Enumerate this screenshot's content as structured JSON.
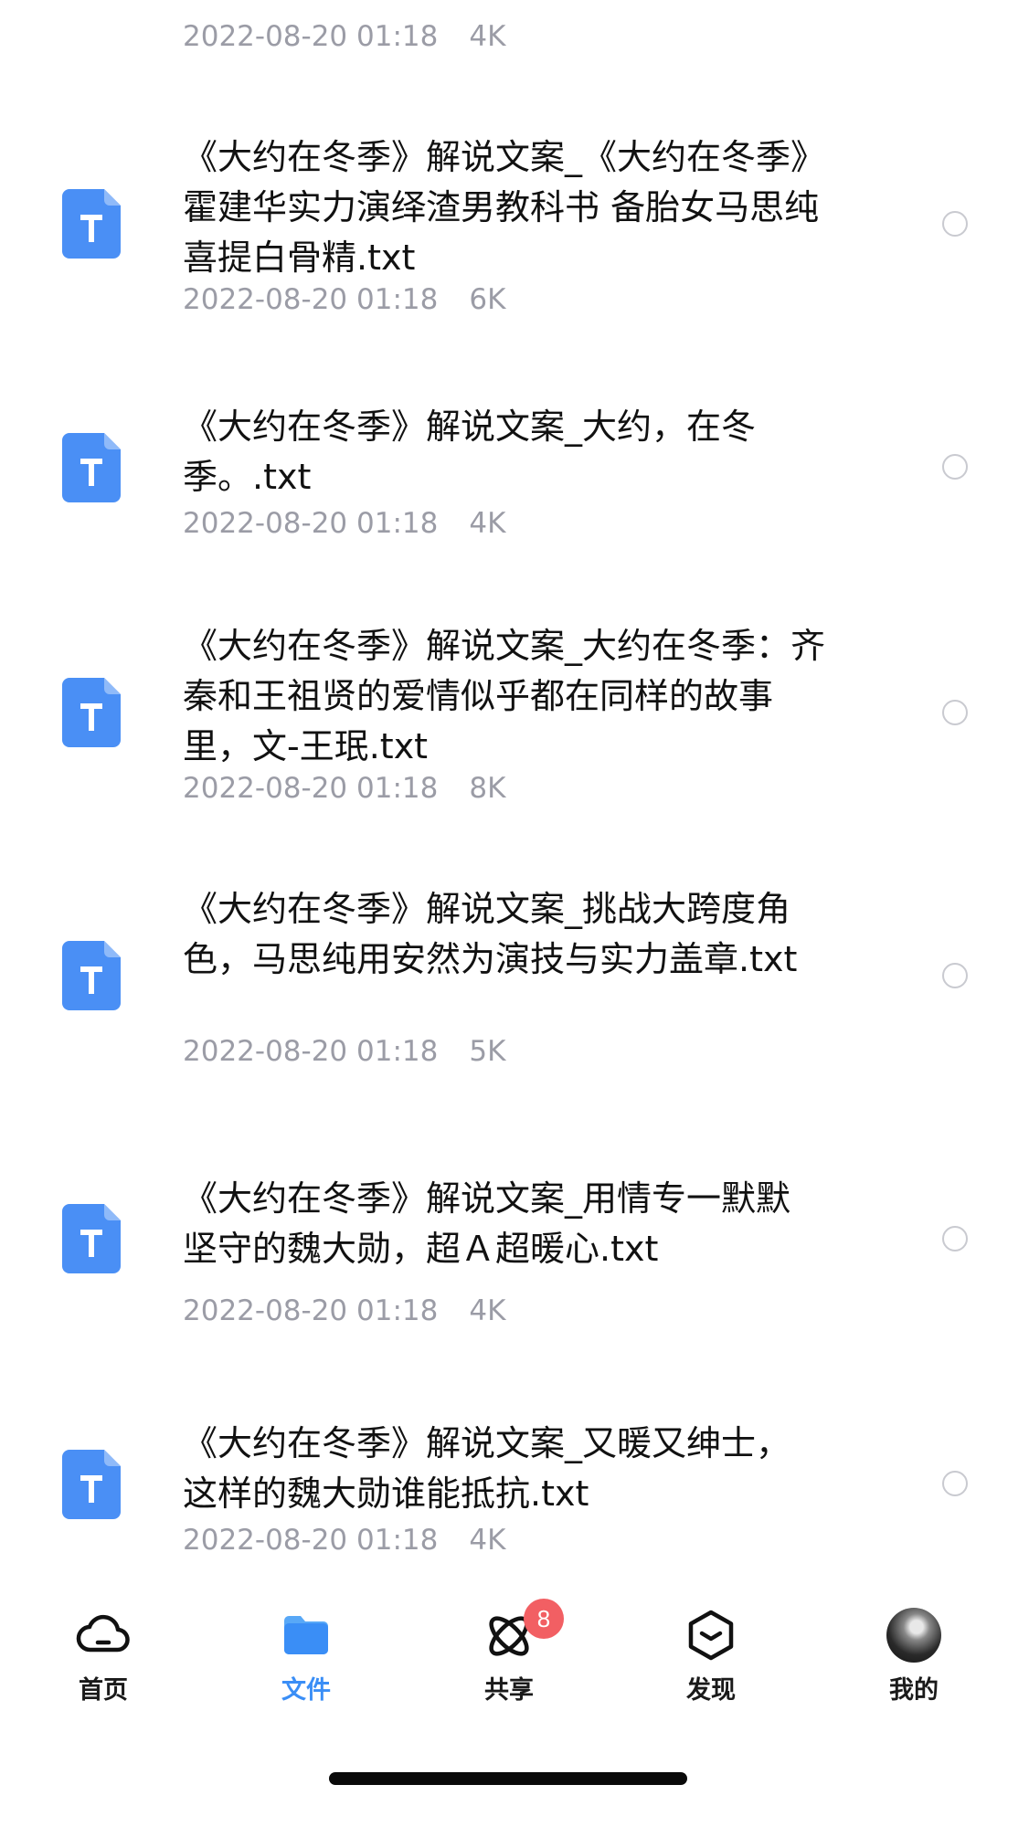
{
  "file_list": {
    "partial_item": {
      "meta_date": "2022-08-20 01:18",
      "meta_size": "4K"
    },
    "items": [
      {
        "icon": "txt-file-icon",
        "title": "《大约在冬季》解说文案_《大约在冬季》霍建华实力演绎渣男教科书 备胎女马思纯喜提白骨精.txt",
        "date": "2022-08-20 01:18",
        "size": "6K",
        "selected": false
      },
      {
        "icon": "txt-file-icon",
        "title": "《大约在冬季》解说文案_大约，在冬季。.txt",
        "date": "2022-08-20 01:18",
        "size": "4K",
        "selected": false
      },
      {
        "icon": "txt-file-icon",
        "title": "《大约在冬季》解说文案_大约在冬季：齐秦和王祖贤的爱情似乎都在同样的故事里，文-王珉.txt",
        "date": "2022-08-20 01:18",
        "size": "8K",
        "selected": false
      },
      {
        "icon": "txt-file-icon",
        "title": "《大约在冬季》解说文案_挑战大跨度角色，马思纯用安然为演技与实力盖章.txt",
        "date": "2022-08-20 01:18",
        "size": "5K",
        "selected": false
      },
      {
        "icon": "txt-file-icon",
        "title": "《大约在冬季》解说文案_用情专一默默坚守的魏大勋，超Ａ超暖心.txt",
        "date": "2022-08-20 01:18",
        "size": "4K",
        "selected": false
      },
      {
        "icon": "txt-file-icon",
        "title": "《大约在冬季》解说文案_又暖又绅士，这样的魏大勋谁能抵抗.txt",
        "date": "2022-08-20 01:18",
        "size": "4K",
        "selected": false
      }
    ]
  },
  "tabbar": {
    "tabs": [
      {
        "label": "首页",
        "icon": "cloud-icon",
        "active": false
      },
      {
        "label": "文件",
        "icon": "folder-icon",
        "active": true
      },
      {
        "label": "共享",
        "icon": "share-orbit-icon",
        "active": false,
        "badge": "8"
      },
      {
        "label": "发现",
        "icon": "discover-icon",
        "active": false
      },
      {
        "label": "我的",
        "icon": "avatar",
        "active": false
      }
    ]
  },
  "colors": {
    "accent": "#3a8ef6",
    "file_icon": "#4a8ff5",
    "meta_text": "#9b9ca6",
    "badge": "#f25f63"
  }
}
